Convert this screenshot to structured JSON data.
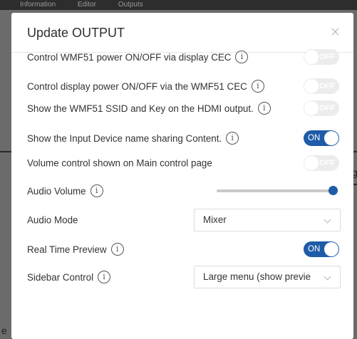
{
  "background": {
    "top_bar_text": [
      "Information",
      "Editor",
      "Outputs"
    ],
    "right_glyph": "g",
    "left_glyph": "e"
  },
  "dialog": {
    "title": "Update OUTPUT",
    "close_label": "×",
    "info_glyph": "i",
    "rows": [
      {
        "label": "Control WMF51 power ON/OFF via display CEC",
        "info": true,
        "type": "toggle",
        "state": "off",
        "toggle_text": "OFF"
      },
      {
        "label": "Control display power ON/OFF via the WMF51 CEC",
        "info": true,
        "type": "toggle",
        "state": "off",
        "toggle_text": "OFF"
      },
      {
        "label": "Show the WMF51 SSID and Key on the HDMI output.",
        "info": true,
        "type": "toggle",
        "state": "off",
        "toggle_text": "OFF"
      },
      {
        "label": "Show the Input Device name sharing Content.",
        "info": true,
        "type": "toggle",
        "state": "on",
        "toggle_text": "ON"
      },
      {
        "label": "Volume control shown on Main control page",
        "info": false,
        "type": "toggle",
        "state": "off",
        "toggle_text": "OFF"
      },
      {
        "label": "Audio Volume",
        "info": true,
        "type": "slider",
        "value_fraction": 1.0
      },
      {
        "label": "Audio Mode",
        "info": false,
        "type": "select",
        "value": "Mixer"
      },
      {
        "label": "Real Time Preview",
        "info": true,
        "type": "toggle",
        "state": "on",
        "toggle_text": "ON"
      },
      {
        "label": "Sidebar Control",
        "info": true,
        "type": "select",
        "value": "Large menu (show previe"
      }
    ]
  },
  "colors": {
    "accent": "#1e5ba8",
    "toggle_off": "#ececec",
    "overlay": "#6b6b6b"
  }
}
